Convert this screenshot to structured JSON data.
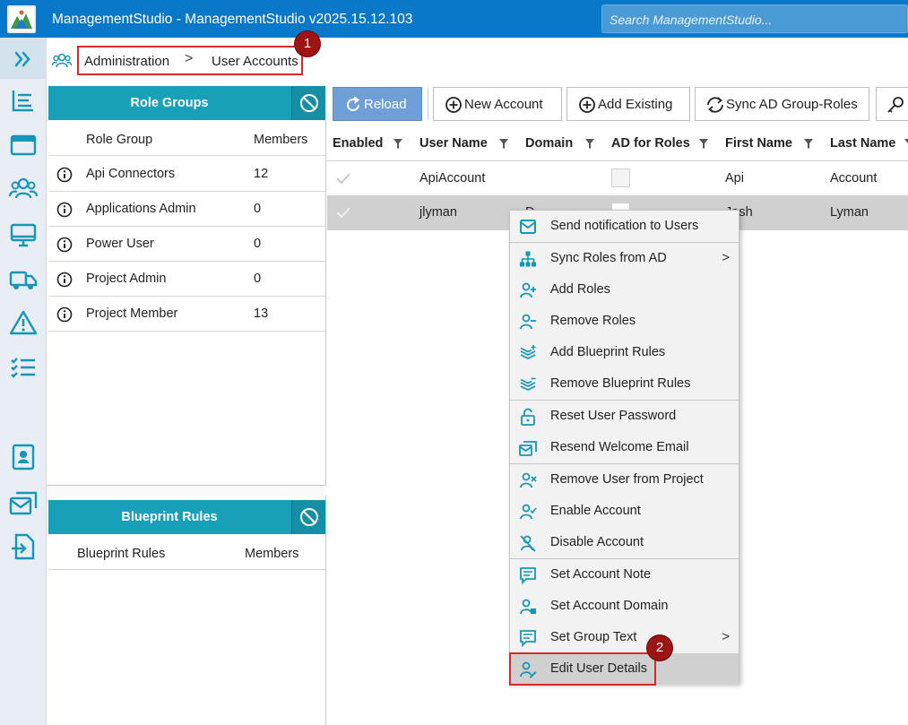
{
  "app": {
    "title": "ManagementStudio - ManagementStudio v2025.15.12.103",
    "search_placeholder": "Search ManagementStudio..."
  },
  "rail": {
    "expand_icon": "chevrons-right-icon",
    "items": [
      "list-icon",
      "browser-icon",
      "users-icon",
      "monitor-icon",
      "truck-icon",
      "warning-icon",
      "checklist-icon",
      "contact-card-icon",
      "email-icon",
      "file-import-icon"
    ]
  },
  "breadcrumb": {
    "level1": "Administration",
    "separator": ">",
    "level2": "User Accounts"
  },
  "markers": {
    "m1": "1",
    "m2": "2"
  },
  "role_groups": {
    "title": "Role Groups",
    "col_name": "Role Group",
    "col_members": "Members",
    "rows": [
      {
        "name": "Api Connectors",
        "members": "12"
      },
      {
        "name": "Applications Admin",
        "members": "0"
      },
      {
        "name": "Power User",
        "members": "0"
      },
      {
        "name": "Project Admin",
        "members": "0"
      },
      {
        "name": "Project Member",
        "members": "13"
      }
    ]
  },
  "blueprint_rules": {
    "title": "Blueprint Rules",
    "col_name": "Blueprint Rules",
    "col_members": "Members"
  },
  "toolbar": {
    "reload": "Reload",
    "new_account": "New Account",
    "add_existing": "Add Existing",
    "sync_ad": "Sync AD Group-Roles"
  },
  "grid": {
    "columns": [
      "Enabled",
      "User Name",
      "Domain",
      "AD for Roles",
      "First Name",
      "Last Name"
    ],
    "rows": [
      {
        "user": "ApiAccount",
        "domain": "",
        "first": "Api",
        "last": "Account"
      },
      {
        "user": "jlyman",
        "domain": "D",
        "first": "Josh",
        "last": "Lyman"
      }
    ]
  },
  "context_menu": {
    "items": [
      {
        "label": "Send notification to Users",
        "icon": "mail-icon"
      },
      {
        "label": "Sync Roles from AD",
        "icon": "hierarchy-icon",
        "submenu": true
      },
      {
        "label": "Add Roles",
        "icon": "user-add-icon"
      },
      {
        "label": "Remove Roles",
        "icon": "user-remove-icon"
      },
      {
        "label": "Add Blueprint Rules",
        "icon": "layers-add-icon"
      },
      {
        "label": "Remove Blueprint Rules",
        "icon": "layers-remove-icon"
      },
      {
        "label": "Reset User Password",
        "icon": "unlock-icon"
      },
      {
        "label": "Resend Welcome Email",
        "icon": "email-resend-icon"
      },
      {
        "label": "Remove User from Project",
        "icon": "user-x-icon"
      },
      {
        "label": "Enable Account",
        "icon": "user-check-icon"
      },
      {
        "label": "Disable Account",
        "icon": "user-disable-icon"
      },
      {
        "label": "Set Account Note",
        "icon": "note-icon"
      },
      {
        "label": "Set Account Domain",
        "icon": "user-domain-icon"
      },
      {
        "label": "Set Group Text",
        "icon": "group-text-icon",
        "submenu": true
      },
      {
        "label": "Edit User Details",
        "icon": "user-edit-icon"
      }
    ],
    "submenu_arrow": ">"
  },
  "colors": {
    "titlebar": "#0a78c8",
    "panel_header": "#17a0b8",
    "accent_icon": "#1796b8",
    "marker": "#9c1414",
    "highlight_border": "#d42a2a"
  }
}
